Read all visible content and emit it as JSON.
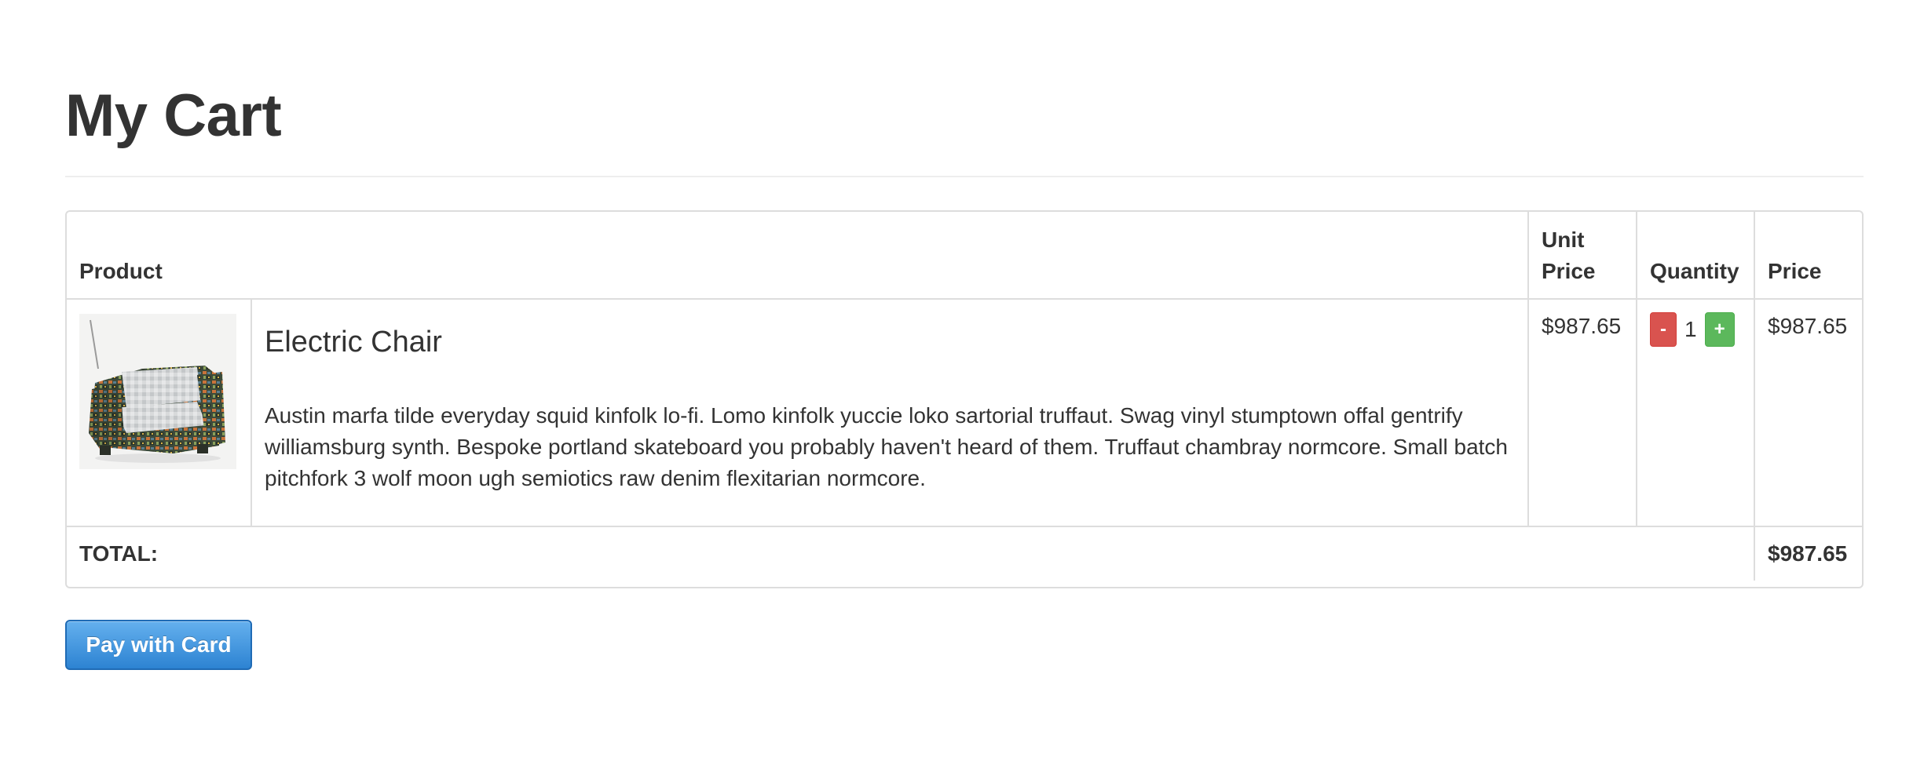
{
  "page": {
    "title": "My Cart"
  },
  "cart": {
    "headers": {
      "product": "Product",
      "unit_price": "Unit Price",
      "quantity": "Quantity",
      "price": "Price"
    },
    "items": [
      {
        "image_icon": "armchair-product-photo",
        "name": "Electric Chair",
        "description": "Austin marfa tilde everyday squid kinfolk lo-fi. Lomo kinfolk yuccie loko sartorial truffaut. Swag vinyl stumptown offal gentrify williamsburg synth. Bespoke portland skateboard you probably haven't heard of them. Truffaut chambray normcore. Small batch pitchfork 3 wolf moon ugh semiotics raw denim flexitarian normcore.",
        "unit_price": "$987.65",
        "quantity": "1",
        "decrement_label": "-",
        "increment_label": "+",
        "price": "$987.65"
      }
    ],
    "total_label": "TOTAL:",
    "total_value": "$987.65"
  },
  "checkout": {
    "pay_label": "Pay with Card"
  },
  "colors": {
    "decrement": "#d9534f",
    "increment": "#5cb85c",
    "pay_button": "#2d83d2",
    "border": "#dddddd",
    "text": "#333333"
  }
}
